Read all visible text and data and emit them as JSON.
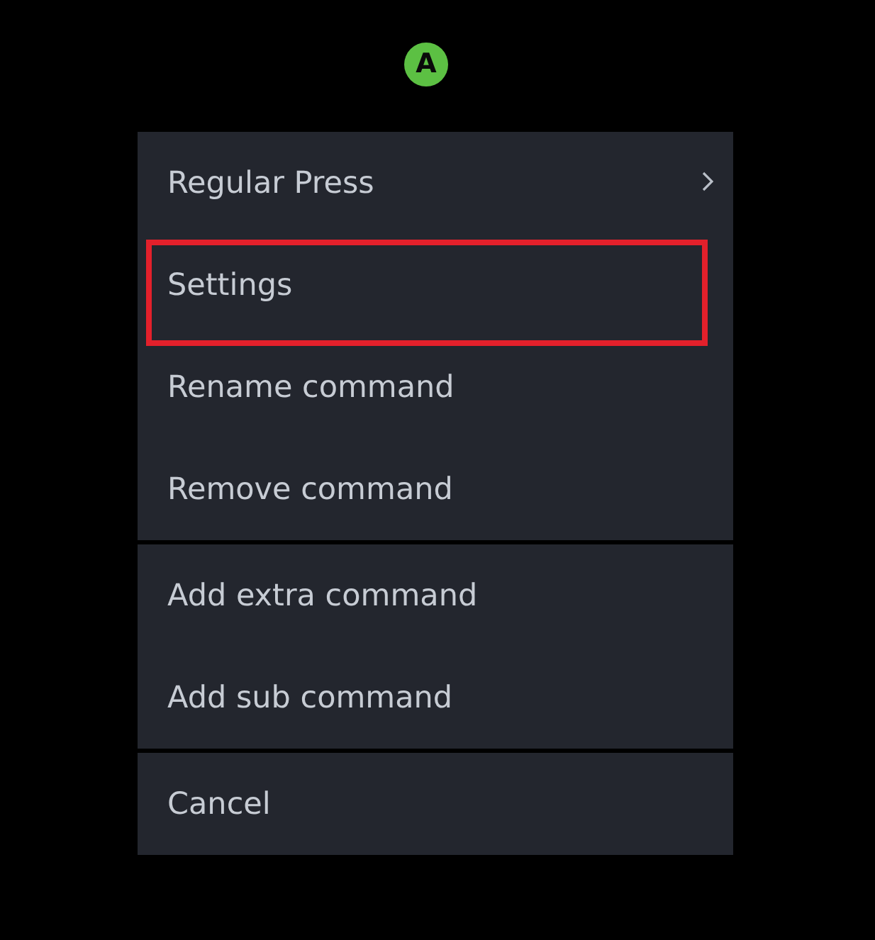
{
  "badge": {
    "label": "A"
  },
  "menu": {
    "groups": [
      {
        "items": [
          {
            "label": "Regular Press",
            "submenu": true,
            "highlighted": false
          },
          {
            "label": "Settings",
            "submenu": false,
            "highlighted": true
          },
          {
            "label": "Rename command",
            "submenu": false,
            "highlighted": false
          },
          {
            "label": "Remove command",
            "submenu": false,
            "highlighted": false
          }
        ]
      },
      {
        "items": [
          {
            "label": "Add extra command",
            "submenu": false,
            "highlighted": false
          },
          {
            "label": "Add sub command",
            "submenu": false,
            "highlighted": false
          }
        ]
      },
      {
        "items": [
          {
            "label": "Cancel",
            "submenu": false,
            "highlighted": false
          }
        ]
      }
    ]
  }
}
